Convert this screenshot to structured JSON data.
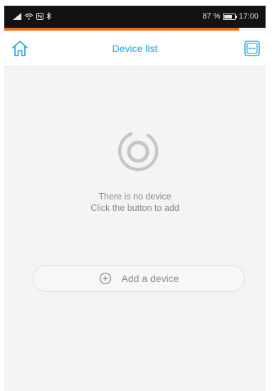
{
  "status_bar": {
    "battery_percent": "87 %",
    "time": "17:00",
    "icons": [
      "signal-icon",
      "wifi-icon",
      "nfc-icon",
      "bluetooth-icon",
      "battery-icon"
    ]
  },
  "header": {
    "title": "Device list",
    "left_icon": "home-icon",
    "right_icon": "scan-icon"
  },
  "empty_state": {
    "icon": "empty-device-icon",
    "line1": "There is no device",
    "line2": "Click the button to add"
  },
  "add_device": {
    "label": "Add a device",
    "icon": "plus-circle-icon"
  },
  "colors": {
    "accent": "#2aa7e2",
    "status_accent": "#f06a16",
    "text_muted": "#8a8a8a"
  }
}
